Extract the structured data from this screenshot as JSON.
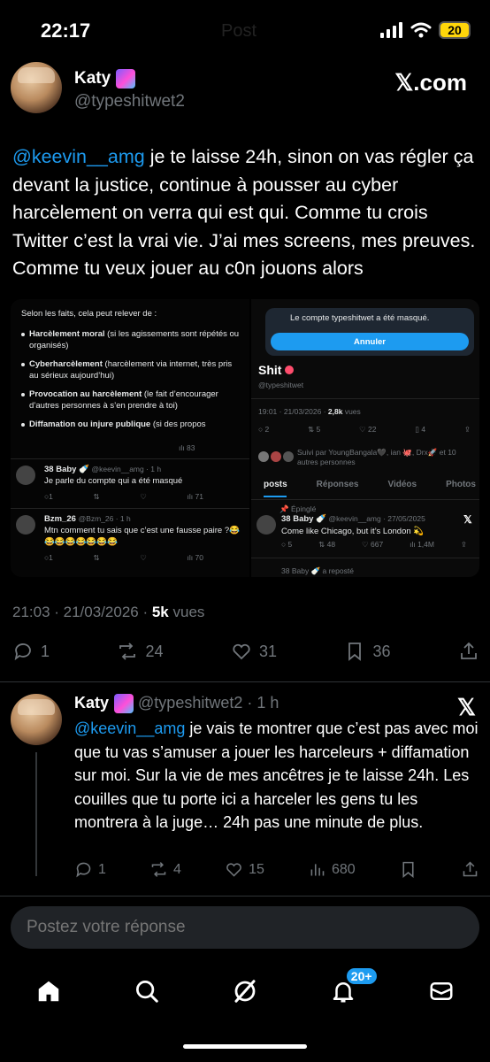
{
  "status_bar": {
    "time": "22:17",
    "ghost_title": "Post",
    "battery": "20"
  },
  "tweet": {
    "author_name": "Katy",
    "author_handle": "@typeshitwet2",
    "brand": "𝕏.com",
    "mention": "@keevin__amg",
    "text": " je te laisse 24h, sinon on vas régler ça devant la justice, continue à pousser au cyber harcèlement on verra qui est qui. Comme tu crois Twitter c’est la vrai vie. J’ai mes screens, mes preuves. Comme tu veux jouer au c0n jouons alors",
    "timestamp": "21:03 · 21/03/2026 · ",
    "views_count": "5k",
    "views_label": " vues",
    "stats": {
      "replies": "1",
      "reposts": "24",
      "likes": "31",
      "bookmarks": "36"
    }
  },
  "media": {
    "left": {
      "intro": "Selon les faits, cela peut relever de :",
      "items": [
        {
          "bold": "Harcèlement moral",
          "rest": " (si les agissements sont répétés ou organisés)"
        },
        {
          "bold": "Cyberharcèlement",
          "rest": " (harcèlement via internet, très pris au sérieux aujourd’hui)"
        },
        {
          "bold": "Provocation au harcèlement",
          "rest": " (le fait d’encourager d’autres personnes à s’en prendre à toi)"
        },
        {
          "bold": "Diffamation ou injure publique",
          "rest": " (si des propos"
        }
      ],
      "stat1": "83",
      "reply1": {
        "name": "38 Baby 🍼",
        "meta": "@keevin__amg · 1 h",
        "text": "Je parle du compte qui a été masqué",
        "views": "71"
      },
      "reply2": {
        "name": "Bzm_26",
        "meta": "@Bzm_26 · 1 h",
        "text": "Mtn comment tu sais que c’est une fausse paire ?😂😂😂😂😂😂😂😂",
        "views": "70"
      }
    },
    "right": {
      "masked_text": "Le compte typeshitwet a été masqué.",
      "cancel_label": "Annuler",
      "profile_name": "Shit",
      "profile_handle": "@typeshitwet",
      "date_line": "19:01 · 21/03/2026 · ",
      "date_views": "2,8k",
      "date_views_label": " vues",
      "stats": {
        "replies": "2",
        "reposts": "5",
        "likes": "22",
        "bookmarks": "4"
      },
      "followed_by": "Suivi par YoungBangala🖤, ian 🐙, Drx🚀 et 10 autres personnes",
      "tabs": [
        "posts",
        "Réponses",
        "Vidéos",
        "Photos"
      ],
      "pinned_label": "Épinglé",
      "pinned_name": "38 Baby 🍼",
      "pinned_meta": "@keevin__amg · 27/05/2025",
      "pinned_text": "Come like Chicago, but it’s London 💫",
      "pinned_stats": {
        "replies": "5",
        "reposts": "48",
        "likes": "667",
        "views": "1,4M"
      },
      "footer_text": "38 Baby 🍼 a reposté"
    }
  },
  "reply": {
    "author_name": "Katy",
    "author_handle": "@typeshitwet2",
    "time": " · 1 h",
    "mention": "@keevin__amg",
    "text": " je vais te montrer que c’est pas avec moi que tu vas s’amuser a jouer les harceleurs + diffamation sur moi. Sur la vie de mes ancêtres je te laisse 24h. Les couilles que tu porte ici a harceler les gens tu les montrera à la juge… 24h pas une minute de plus.",
    "stats": {
      "replies": "1",
      "reposts": "4",
      "likes": "15",
      "views": "680"
    }
  },
  "composer": {
    "placeholder": "Postez votre réponse"
  },
  "nav": {
    "notifications_badge": "20+"
  },
  "colors": {
    "accent": "#1d9bf0",
    "muted": "#71767b",
    "background": "#000000"
  }
}
